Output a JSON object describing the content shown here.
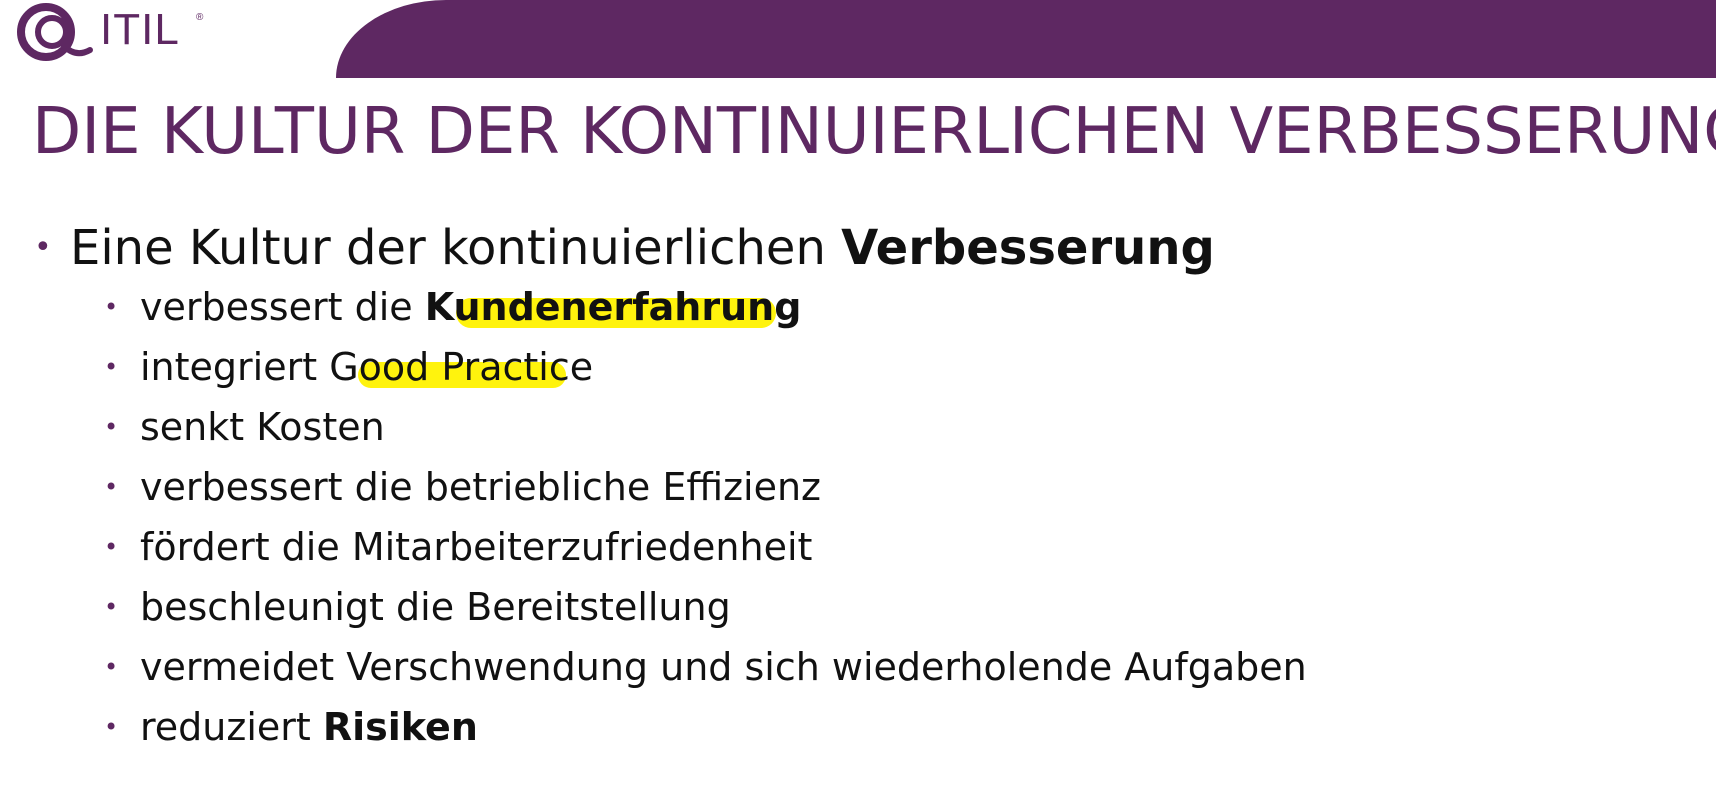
{
  "logo": {
    "text": "ITIL",
    "registered": "®",
    "icon": "itil-swirl-logo"
  },
  "title": "DIE KULTUR DER KONTINUIERLICHEN VERBESSERUNG",
  "bullets": {
    "main": {
      "prefix": "Eine Kultur der kontinuierlichen ",
      "emphasis": "Verbesserung"
    },
    "items": [
      {
        "prefix": "verbessert die ",
        "emphasis": "Kundenerfahrung",
        "suffix": ""
      },
      {
        "prefix": "integriert ",
        "emphasis": "",
        "suffix": "Good Practice"
      },
      {
        "prefix": "senkt Kosten",
        "emphasis": "",
        "suffix": ""
      },
      {
        "prefix": "verbessert die betriebliche Effizienz",
        "emphasis": "",
        "suffix": ""
      },
      {
        "prefix": "fördert die Mitarbeiterzufriedenheit",
        "emphasis": "",
        "suffix": ""
      },
      {
        "prefix": "beschleunigt die Bereitstellung",
        "emphasis": "",
        "suffix": ""
      },
      {
        "prefix": "vermeidet Verschwendung und sich wiederholende Aufgaben",
        "emphasis": "",
        "suffix": ""
      },
      {
        "prefix": "reduziert ",
        "emphasis": "Risiken",
        "suffix": ""
      }
    ]
  },
  "highlights": [
    "Kundenerfahrung",
    "Good Practice"
  ],
  "colors": {
    "accent": "#5e2862",
    "highlight": "#fff200",
    "text": "#111111"
  }
}
